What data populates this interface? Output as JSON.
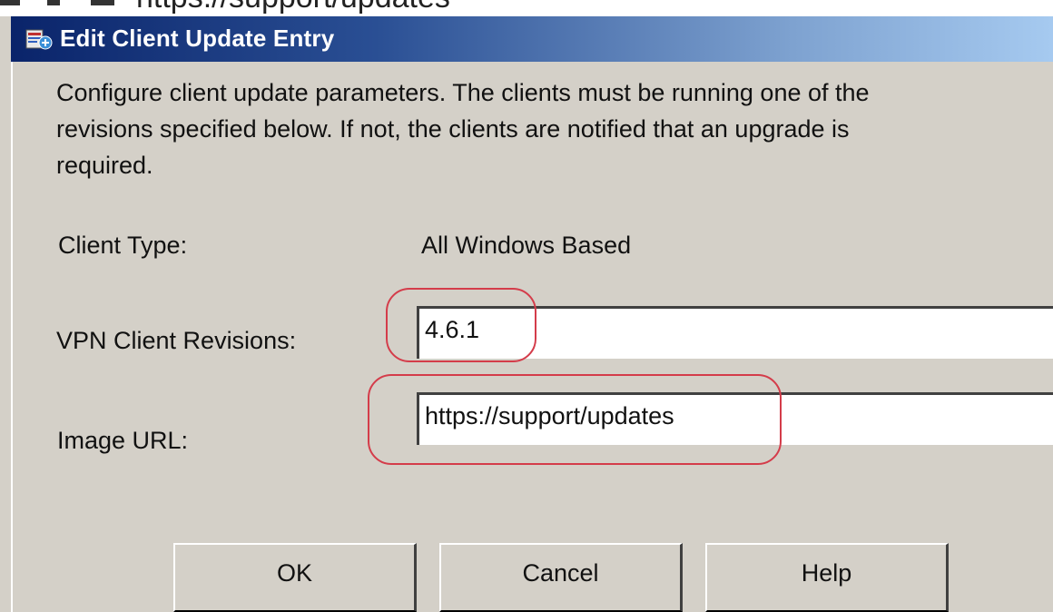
{
  "window": {
    "title": "Edit Client Update Entry",
    "icon": "dialog-app-icon",
    "background_strip_text": "https://support/updates"
  },
  "description": "Configure client update parameters.  The clients must be running one of the\nrevisions specified below.  If not, the clients are notified that an upgrade is\nrequired.",
  "form": {
    "client_type_label": "Client Type:",
    "client_type_value": "All Windows Based",
    "vpn_revisions_label": "VPN Client Revisions:",
    "vpn_revisions_value": "4.6.1",
    "image_url_label": "Image URL:",
    "image_url_value": "https://support/updates"
  },
  "buttons": {
    "ok": "OK",
    "cancel": "Cancel",
    "help": "Help"
  },
  "colors": {
    "dialog_bg": "#d4d0c8",
    "title_gradient_start": "#0a246a",
    "title_gradient_end": "#a6caf0",
    "annotation_red": "#d43c4a"
  }
}
